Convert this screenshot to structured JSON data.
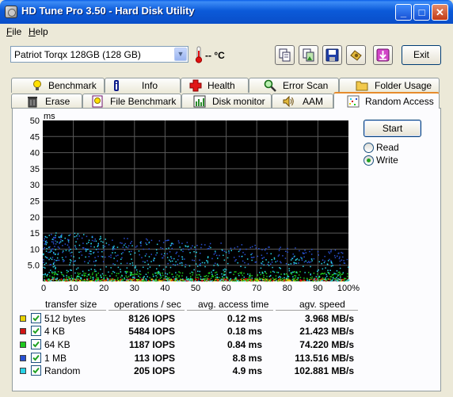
{
  "window": {
    "title": "HD Tune Pro 3.50 - Hard Disk Utility",
    "minimize": "_",
    "maximize": "□",
    "close": "✕"
  },
  "menu": {
    "file_key": "F",
    "file_rest": "ile",
    "help_key": "H",
    "help_rest": "elp"
  },
  "toolbar": {
    "drive": "Patriot Torqx 128GB (128 GB)",
    "temperature": "-- °C",
    "exit_label": "Exit"
  },
  "tabs_row1": [
    {
      "label": "Benchmark",
      "icon": "lightbulb-icon"
    },
    {
      "label": "Info",
      "icon": "info-icon"
    },
    {
      "label": "Health",
      "icon": "health-cross-icon"
    },
    {
      "label": "Error Scan",
      "icon": "magnifier-icon"
    },
    {
      "label": "Folder Usage",
      "icon": "folder-icon"
    }
  ],
  "tabs_row2": [
    {
      "label": "Erase",
      "icon": "trash-icon"
    },
    {
      "label": "File Benchmark",
      "icon": "file-bulb-icon"
    },
    {
      "label": "Disk monitor",
      "icon": "monitor-chart-icon"
    },
    {
      "label": "AAM",
      "icon": "speaker-icon"
    },
    {
      "label": "Random Access",
      "icon": "random-dots-icon",
      "active": true
    }
  ],
  "controls": {
    "start_label": "Start",
    "read_label": "Read",
    "write_label": "Write",
    "selected": "write"
  },
  "table": {
    "headers": [
      "transfer size",
      "operations / sec",
      "avg. access time",
      "agv. speed"
    ],
    "rows": [
      {
        "size": "512 bytes",
        "iops": "8126 IOPS",
        "access": "0.12 ms",
        "speed": "3.968 MB/s",
        "color": "#e8d200",
        "checked": true
      },
      {
        "size": "4 KB",
        "iops": "5484 IOPS",
        "access": "0.18 ms",
        "speed": "21.423 MB/s",
        "color": "#d21414",
        "checked": true
      },
      {
        "size": "64 KB",
        "iops": "1187 IOPS",
        "access": "0.84 ms",
        "speed": "74.220 MB/s",
        "color": "#1ec81e",
        "checked": true
      },
      {
        "size": "1 MB",
        "iops": "113 IOPS",
        "access": "8.8 ms",
        "speed": "113.516 MB/s",
        "color": "#2850d2",
        "checked": true
      },
      {
        "size": "Random",
        "iops": "205 IOPS",
        "access": "4.9 ms",
        "speed": "102.881 MB/s",
        "color": "#28d2e6",
        "checked": true
      }
    ]
  },
  "chart_data": {
    "type": "scatter",
    "ylabel": "ms",
    "ylim": [
      0,
      50
    ],
    "xlim": [
      0,
      100
    ],
    "y_ticks": [
      "50",
      "45",
      "40",
      "35",
      "30",
      "25",
      "20",
      "15",
      "10",
      "5.0"
    ],
    "x_ticks": [
      "0",
      "10",
      "20",
      "30",
      "40",
      "50",
      "60",
      "70",
      "80",
      "90",
      "100%"
    ],
    "grid": true,
    "series": [
      {
        "color": "#e8d200",
        "y_range": [
          0,
          0.6
        ],
        "density": "very dense, along the bottom edge"
      },
      {
        "color": "#d21414",
        "y_range": [
          0,
          0.8
        ],
        "density": "dense, along the bottom edge"
      },
      {
        "color": "#1ec81e",
        "y_range": [
          0,
          3
        ],
        "density": "dense near 0-3 ms"
      },
      {
        "color": "#2850d2",
        "y_range": [
          5,
          15
        ],
        "density": "denser on the left"
      },
      {
        "color": "#28d2e6",
        "y_range": [
          0,
          16
        ],
        "density": "widely scattered, denser on the left"
      }
    ]
  }
}
